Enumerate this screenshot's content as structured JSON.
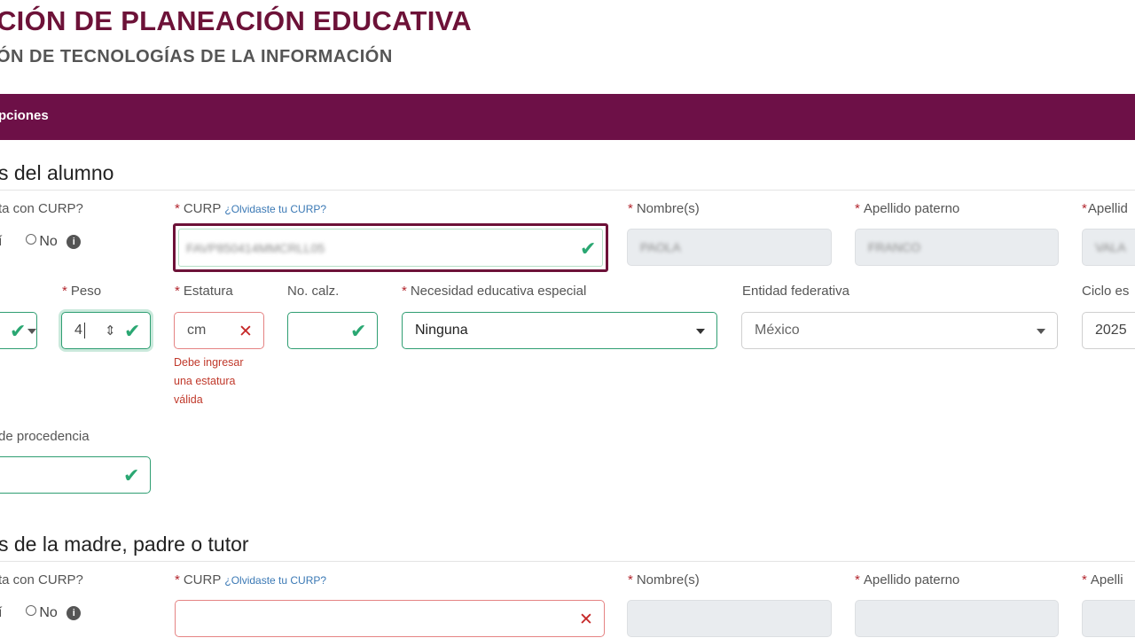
{
  "header": {
    "title": "CIÓN DE PLANEACIÓN EDUCATIVA",
    "subtitle": "ÓN DE TECNOLOGÍAS DE LA INFORMACIÓN"
  },
  "band": {
    "label": "pciones"
  },
  "student": {
    "section_title": "s del alumno",
    "has_curp_label": "ta con CURP?",
    "radio_si": "í",
    "radio_no": "No",
    "curp_label": "CURP",
    "curp_link": "¿Olvidaste tu CURP?",
    "curp_value": "FAVP850414MMCRLL05",
    "nombre_label": "Nombre(s)",
    "nombre_value": "PAOLA",
    "ap_paterno_label": "Apellido paterno",
    "ap_paterno_value": "FRANCO",
    "ap_materno_label": "Apellid",
    "ap_materno_value": "VALA",
    "peso_label": "Peso",
    "peso_value": "4",
    "estatura_label": "Estatura",
    "estatura_placeholder": "cm",
    "estatura_error": [
      "Debe ingresar",
      "una estatura",
      "válida"
    ],
    "calzado_label": "No. calz.",
    "necesidad_label": "Necesidad educativa especial",
    "necesidad_value": "Ninguna",
    "entidad_label": "Entidad federativa",
    "entidad_value": "México",
    "ciclo_label": "Ciclo es",
    "ciclo_value": "2025",
    "procedencia_label": "de procedencia"
  },
  "tutor": {
    "section_title": "s de la madre, padre o tutor",
    "has_curp_label": "ta con CURP?",
    "radio_si": "í",
    "radio_no": "No",
    "curp_label": "CURP",
    "curp_link": "¿Olvidaste tu CURP?",
    "nombre_label": "Nombre(s)",
    "ap_paterno_label": "Apellido paterno",
    "ap_materno_label": "Apelli"
  },
  "colors": {
    "brand": "#6d1047",
    "valid": "#2aa772",
    "error": "#c62828"
  }
}
